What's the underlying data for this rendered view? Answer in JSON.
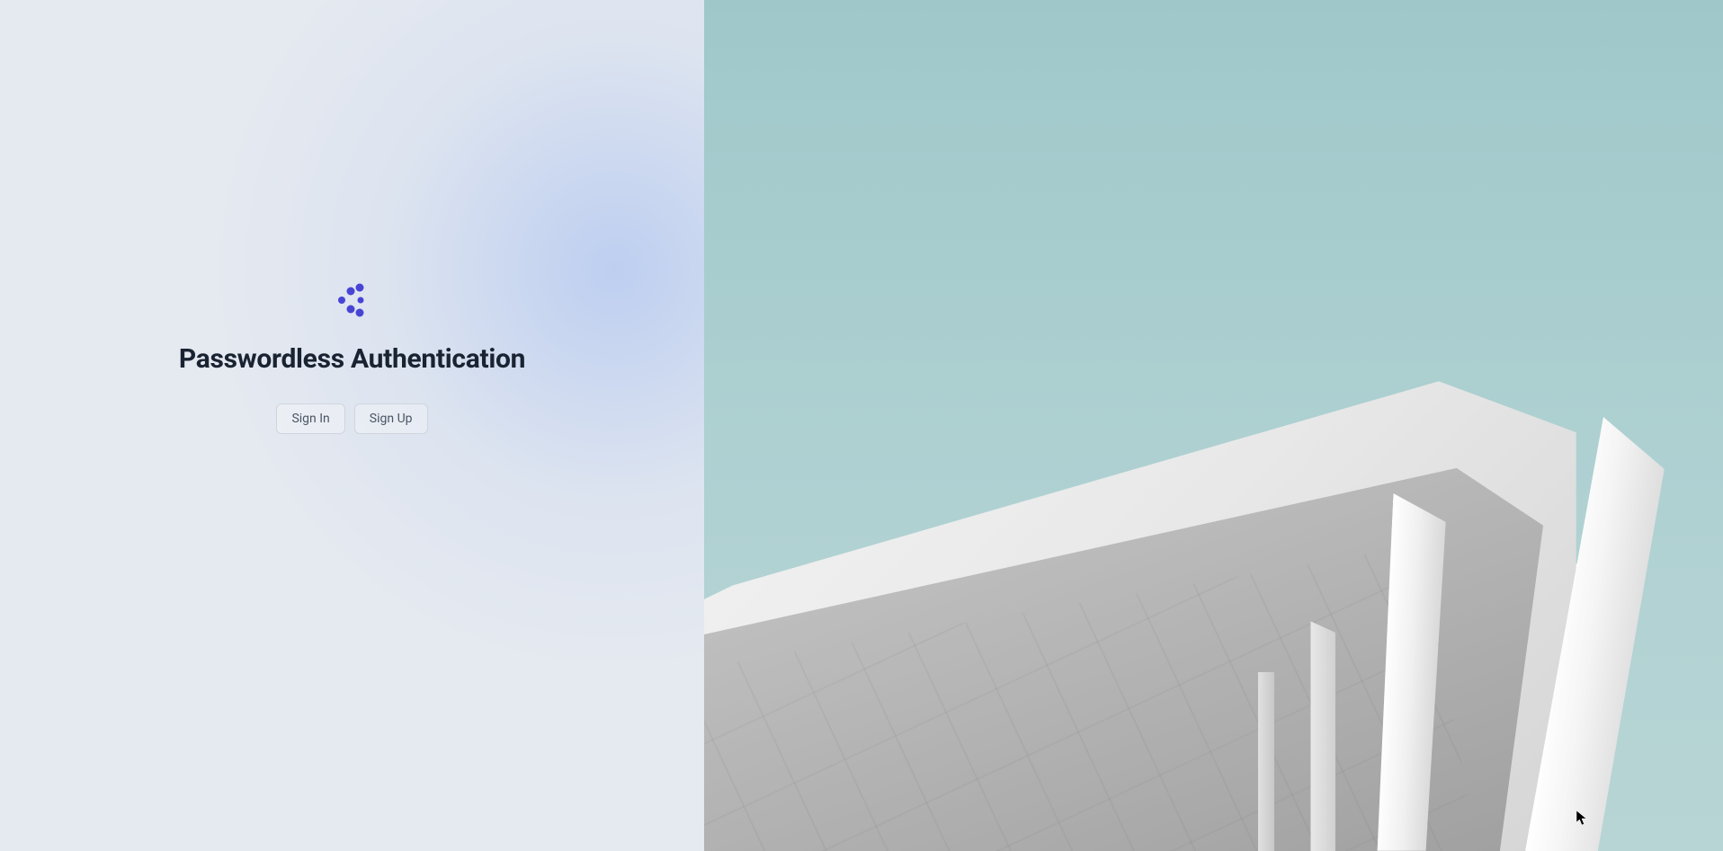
{
  "page": {
    "title": "Passwordless Authentication"
  },
  "buttons": {
    "signin_label": "Sign In",
    "signup_label": "Sign Up"
  },
  "colors": {
    "logo_primary": "#4844d4",
    "text_primary": "#1a2332"
  }
}
